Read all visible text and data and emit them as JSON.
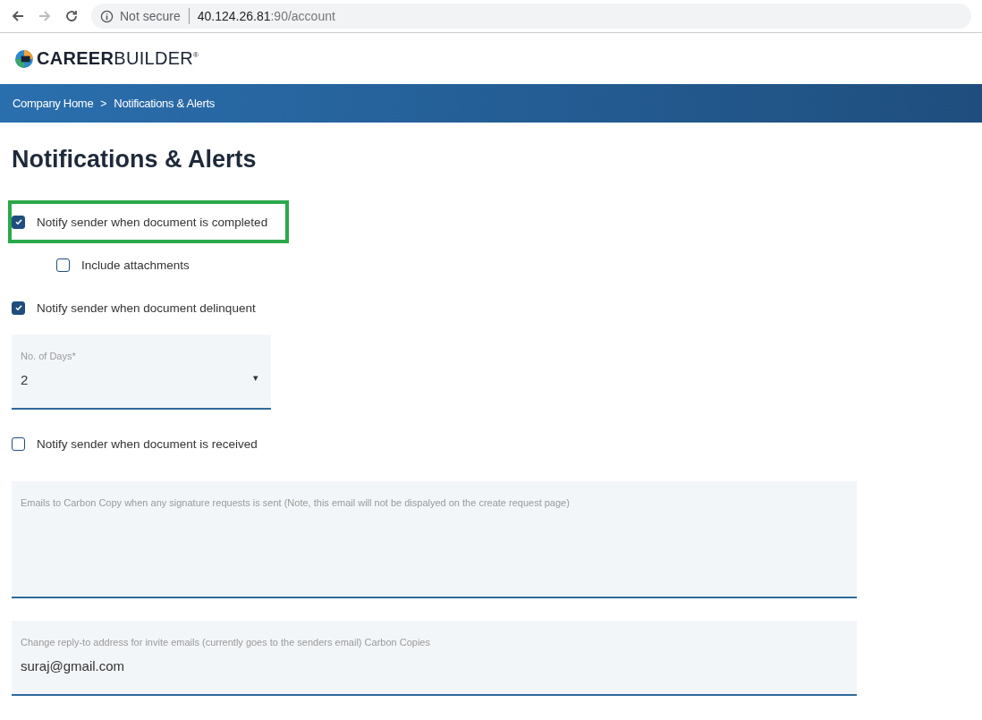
{
  "browser": {
    "security": "Not secure",
    "url_host": "40.124.26.81",
    "url_rest": ":90/account"
  },
  "logo": {
    "bold": "CAREER",
    "light": "BUILDER",
    "mark": "®"
  },
  "breadcrumb": [
    "Company Home",
    "Notifications & Alerts"
  ],
  "breadcrumb_separator": ">",
  "page_title": "Notifications & Alerts",
  "options": [
    {
      "kind": "checkbox",
      "label": "Notify sender when document is completed",
      "checked": true,
      "highlighted": true,
      "children": [
        {
          "kind": "checkbox",
          "label": "Include attachments",
          "checked": false,
          "highlighted": false
        }
      ]
    },
    {
      "kind": "checkbox",
      "label": "Notify sender when document delinquent",
      "checked": true,
      "highlighted": false
    },
    {
      "kind": "select",
      "label": "No. of Days*",
      "value": "2",
      "caret": "▾"
    },
    {
      "kind": "checkbox",
      "label": "Notify sender when document is received",
      "checked": false,
      "highlighted": false
    },
    {
      "kind": "textarea",
      "label": "Emails to Carbon Copy when any signature requests is sent (Note, this email will not be dispalyed on the create request page)"
    },
    {
      "kind": "text",
      "label": "Change reply-to address for invite emails (currently goes to the senders email) Carbon Copies",
      "value": "suraj@gmail.com"
    }
  ]
}
